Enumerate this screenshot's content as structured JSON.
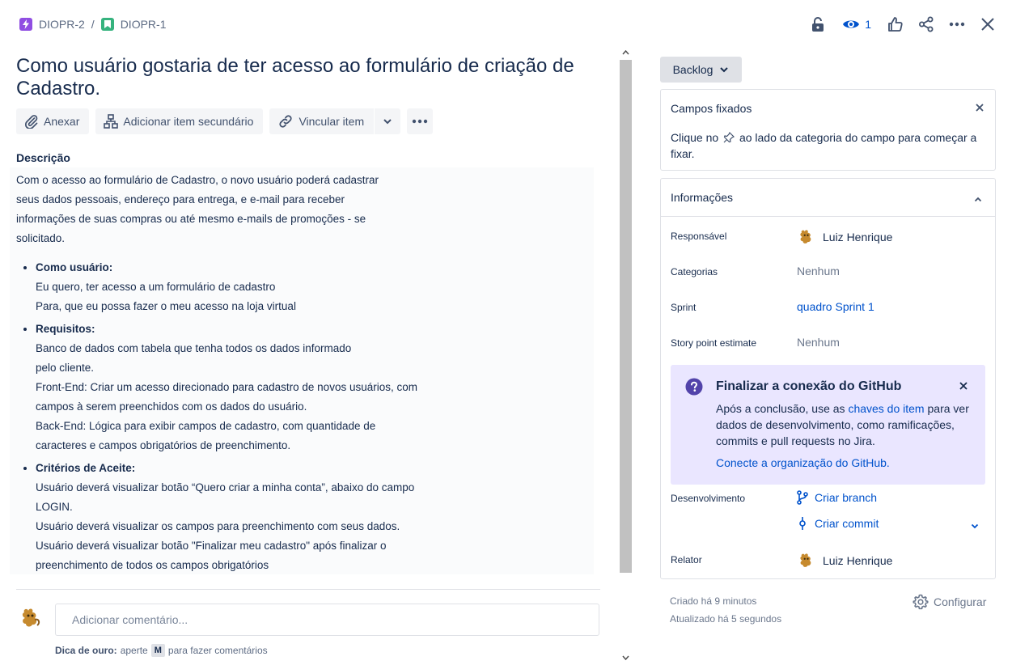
{
  "breadcrumb": {
    "parent": "DIOPR-2",
    "separator": "/",
    "current": "DIOPR-1"
  },
  "header": {
    "watch_count": "1",
    "icons": [
      "lock-icon",
      "eye-icon",
      "thumbs-up-icon",
      "share-icon",
      "more-icon",
      "close-icon"
    ]
  },
  "issue": {
    "title": "Como usuário gostaria de ter acesso ao formulário de criação de Cadastro."
  },
  "actions": {
    "attach": "Anexar",
    "add_child": "Adicionar item secundário",
    "link": "Vincular item"
  },
  "description": {
    "label": "Descrição",
    "intro": "Com o acesso ao formulário de Cadastro, o novo usuário poderá cadastrar seus dados pessoais, endereço para entrega, e e-mail para receber informações de suas compras ou até mesmo e-mails de promoções - se solicitado.",
    "sections": [
      {
        "heading": "Como usuário:",
        "lines": [
          "Eu quero, ter acesso a um formulário de cadastro",
          "Para, que eu possa fazer o meu acesso na loja virtual"
        ]
      },
      {
        "heading": "Requisitos:",
        "lines": [
          "Banco de dados com tabela que tenha todos os dados informado",
          "pelo cliente.",
          "Front-End: Criar um acesso direcionado para cadastro de novos usuários, com",
          "campos à serem preenchidos com os dados do usuário.",
          "Back-End: Lógica para exibir campos de cadastro, com quantidade de",
          "caracteres e campos obrigatórios de preenchimento."
        ]
      },
      {
        "heading": "Critérios de Aceite:",
        "lines": [
          "Usuário deverá visualizar botão “Quero criar a minha conta”, abaixo do campo",
          "LOGIN.",
          "Usuário deverá visualizar os campos para preenchimento com seus dados.",
          "Usuário deverá visualizar botão \"Finalizar meu cadastro\" após finalizar o",
          "preenchimento de todos os campos obrigatórios"
        ]
      }
    ]
  },
  "comment": {
    "placeholder": "Adicionar comentário...",
    "tip_bold": "Dica de ouro:",
    "tip_press": "aperte",
    "tip_key": "M",
    "tip_rest": "para fazer comentários"
  },
  "sidebar": {
    "status": "Backlog",
    "pinned": {
      "title": "Campos fixados",
      "text_before": "Clique no",
      "text_after": "ao lado da categoria do campo para começar a fixar."
    },
    "info": {
      "title": "Informações",
      "assignee_label": "Responsável",
      "assignee_value": "Luiz Henrique",
      "labels_label": "Categorias",
      "labels_value": "Nenhum",
      "sprint_label": "Sprint",
      "sprint_value": "quadro Sprint 1",
      "estimate_label": "Story point estimate",
      "estimate_value": "Nenhum",
      "github": {
        "title": "Finalizar a conexão do GitHub",
        "body_before": "Após a conclusão, use as",
        "body_link": "chaves do item",
        "body_after": "para ver dados de desenvolvimento, como ramificações, commits e pull requests no Jira.",
        "cta": "Conecte a organização do GitHub."
      },
      "dev_label": "Desenvolvimento",
      "create_branch": "Criar branch",
      "create_commit": "Criar commit",
      "reporter_label": "Relator",
      "reporter_value": "Luiz Henrique"
    },
    "created": "Criado há 9 minutos",
    "updated": "Atualizado há 5 segundos",
    "configure": "Configurar"
  },
  "colors": {
    "accent": "#0052cc",
    "epic": "#904ee2",
    "story": "#36b37e",
    "github_banner": "#eae6ff"
  }
}
